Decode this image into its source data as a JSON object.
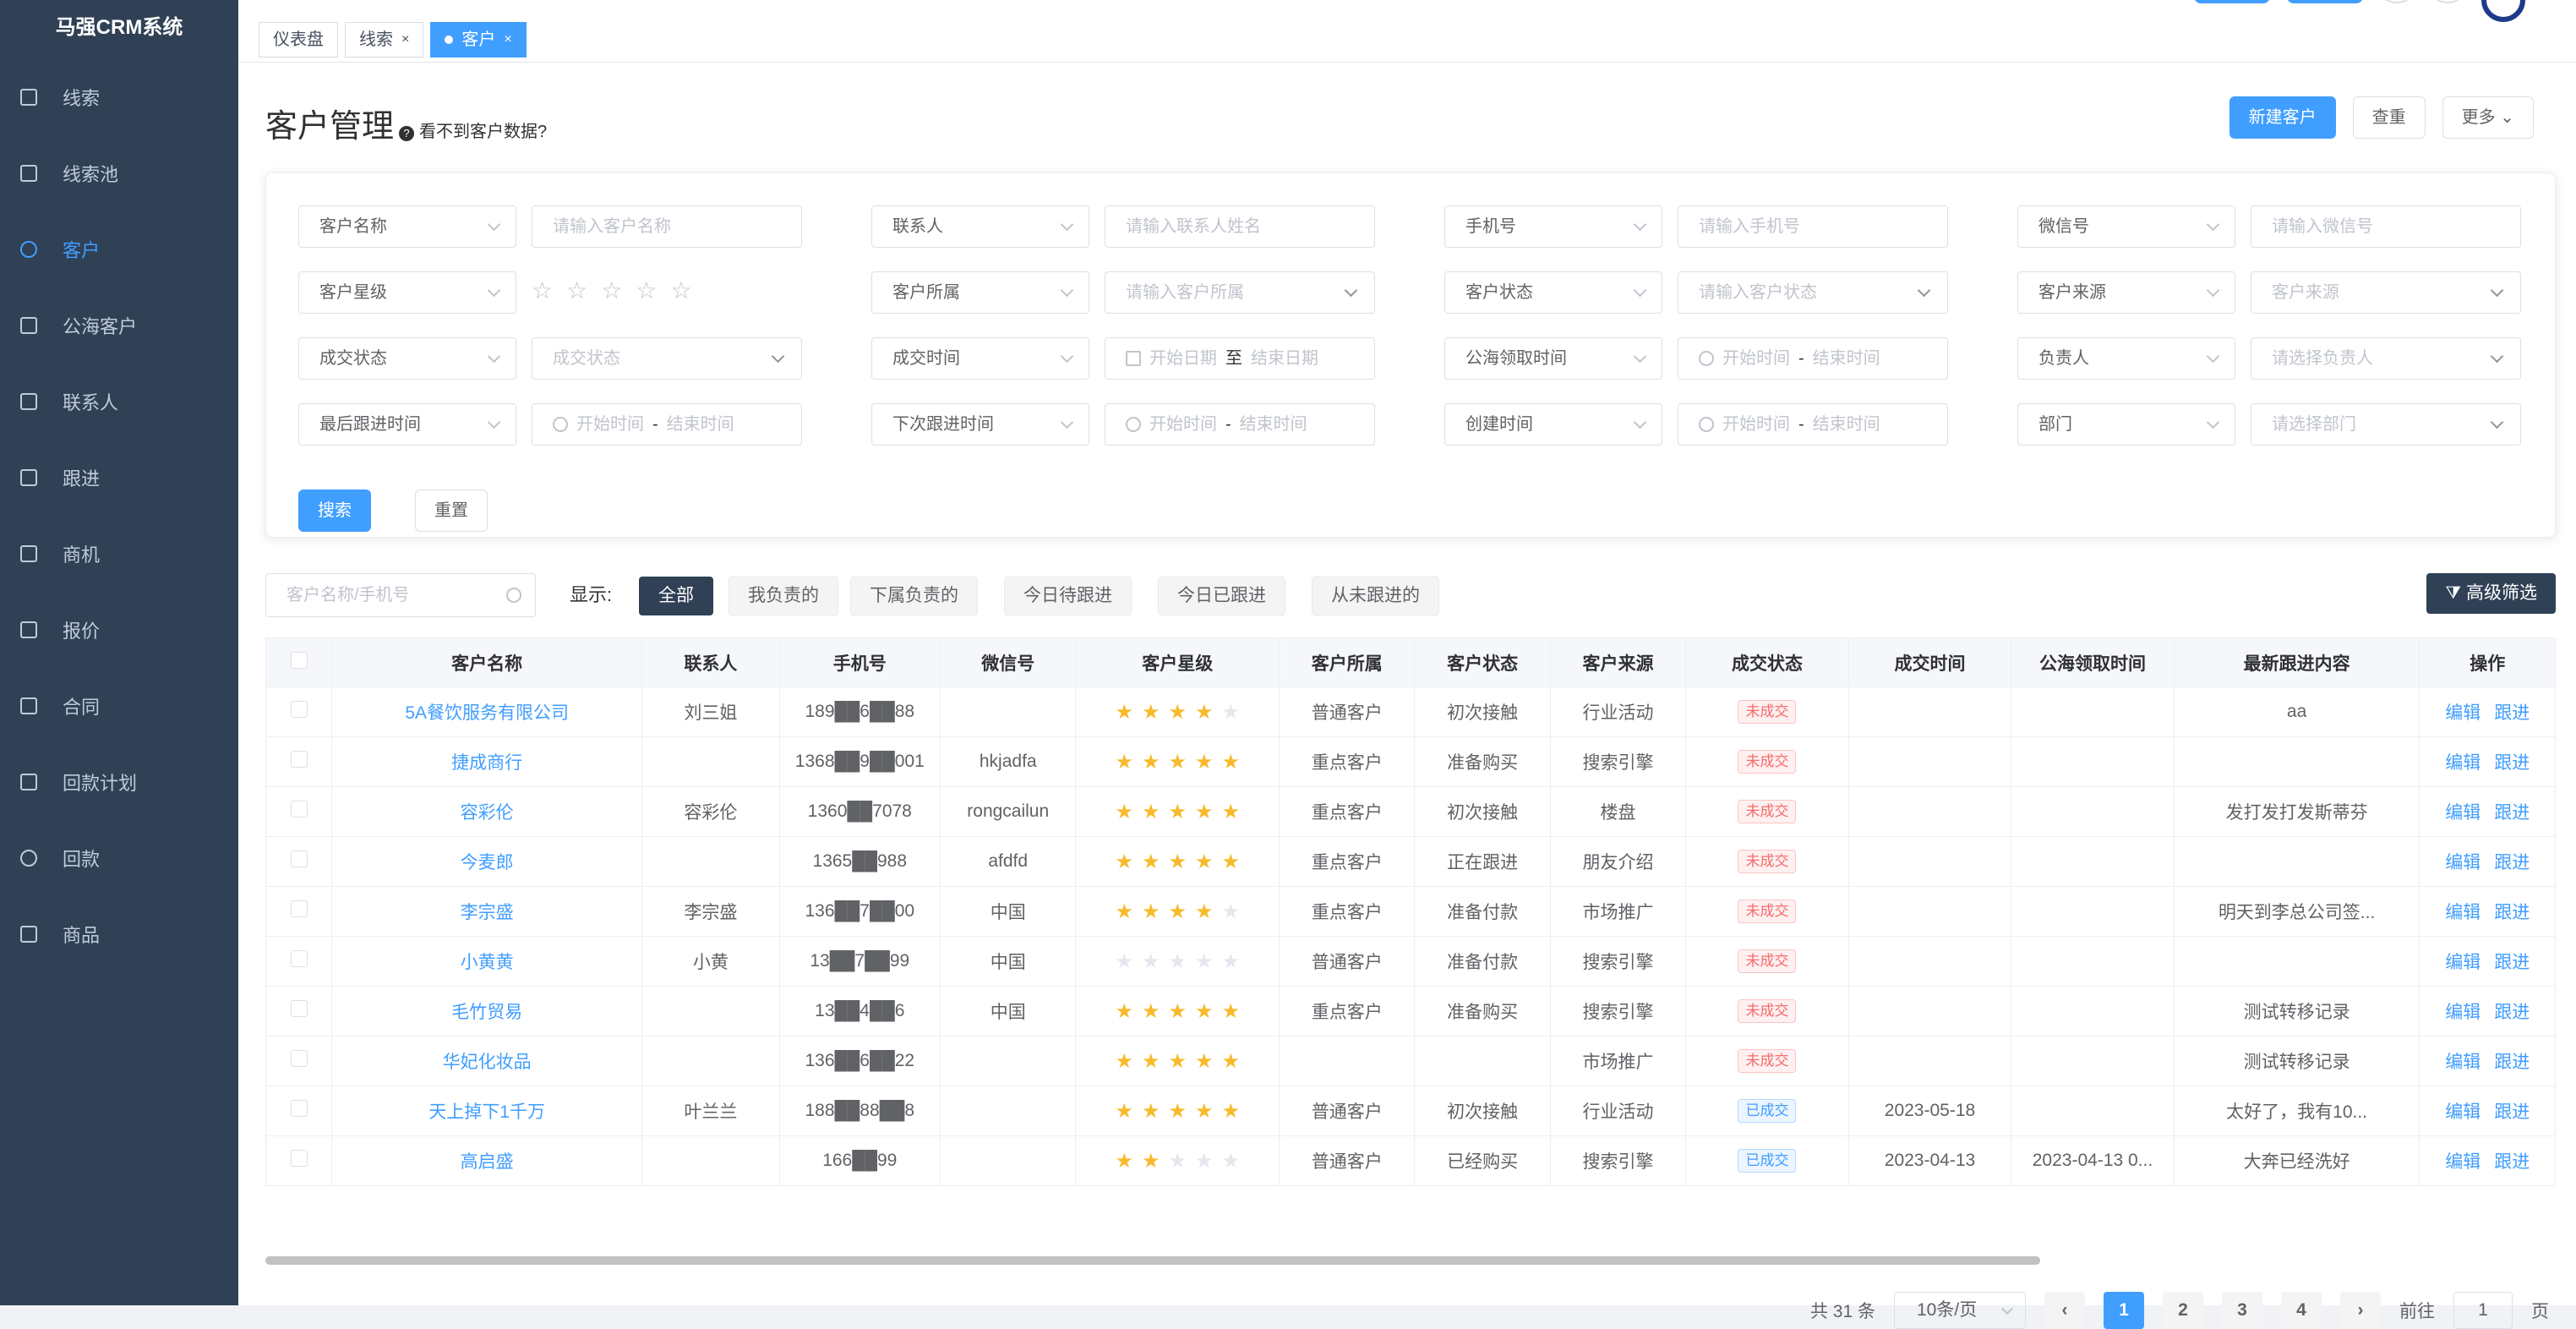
{
  "app": {
    "title": "马强CRM系统"
  },
  "sidebar": {
    "items": [
      {
        "label": "线索",
        "icon": "edit-icon"
      },
      {
        "label": "线索池",
        "icon": "calendar-icon"
      },
      {
        "label": "客户",
        "icon": "customer-icon",
        "active": true
      },
      {
        "label": "公海客户",
        "icon": "user-icon"
      },
      {
        "label": "联系人",
        "icon": "contact-icon"
      },
      {
        "label": "跟进",
        "icon": "document-icon"
      },
      {
        "label": "商机",
        "icon": "opportunity-icon"
      },
      {
        "label": "报价",
        "icon": "quote-icon"
      },
      {
        "label": "合同",
        "icon": "contract-icon"
      },
      {
        "label": "回款计划",
        "icon": "plan-icon"
      },
      {
        "label": "回款",
        "icon": "money-icon"
      },
      {
        "label": "商品",
        "icon": "bag-icon"
      }
    ]
  },
  "tabs": [
    {
      "label": "仪表盘"
    },
    {
      "label": "线索",
      "close": "×"
    },
    {
      "label": "客户",
      "close": "×",
      "active": true
    }
  ],
  "header": {
    "title": "客户管理",
    "help_icon": "?",
    "hint": "看不到客户数据?",
    "new_btn": "新建客户",
    "check_btn": "查重",
    "more_btn": "更多"
  },
  "filters": {
    "row1": [
      {
        "select": "客户名称",
        "placeholder": "请输入客户名称"
      },
      {
        "select": "联系人",
        "placeholder": "请输入联系人姓名"
      },
      {
        "select": "手机号",
        "placeholder": "请输入手机号"
      },
      {
        "select": "微信号",
        "placeholder": "请输入微信号"
      }
    ],
    "row2": [
      {
        "select": "客户星级"
      },
      {
        "select": "客户所属",
        "placeholder": "请输入客户所属"
      },
      {
        "select": "客户状态",
        "placeholder": "请输入客户状态"
      },
      {
        "select": "客户来源",
        "placeholder": "客户来源"
      }
    ],
    "row3": [
      {
        "select": "成交状态",
        "placeholder": "成交状态"
      },
      {
        "select": "成交时间",
        "start": "开始日期",
        "sep": "至",
        "end": "结束日期"
      },
      {
        "select": "公海领取时间",
        "start": "开始时间",
        "sep": "-",
        "end": "结束时间"
      },
      {
        "select": "负责人",
        "placeholder": "请选择负责人"
      }
    ],
    "row4": [
      {
        "select": "最后跟进时间",
        "start": "开始时间",
        "sep": "-",
        "end": "结束时间"
      },
      {
        "select": "下次跟进时间",
        "start": "开始时间",
        "sep": "-",
        "end": "结束时间"
      },
      {
        "select": "创建时间",
        "start": "开始时间",
        "sep": "-",
        "end": "结束时间"
      },
      {
        "select": "部门",
        "placeholder": "请选择部门"
      }
    ],
    "search_btn": "搜索",
    "reset_btn": "重置"
  },
  "toolbar": {
    "search_placeholder": "客户名称/手机号",
    "show_label": "显示:",
    "segments": [
      "全部",
      "我负责的",
      "下属负责的",
      "今日待跟进",
      "今日已跟进",
      "从未跟进的"
    ],
    "active_segment": "全部",
    "advanced_btn": "高级筛选"
  },
  "table": {
    "columns": [
      "客户名称",
      "联系人",
      "手机号",
      "微信号",
      "客户星级",
      "客户所属",
      "客户状态",
      "客户来源",
      "成交状态",
      "成交时间",
      "公海领取时间",
      "最新跟进内容",
      "操作"
    ],
    "edit_label": "编辑",
    "follow_label": "跟进",
    "rows": [
      {
        "name": "5A餐饮服务有限公司",
        "contact": "刘三姐",
        "phone": "189██6██88",
        "wechat": "",
        "stars": 4,
        "owner": "普通客户",
        "status": "初次接触",
        "source": "行业活动",
        "deal": "未成交",
        "deal_time": "",
        "pool_time": "",
        "latest": "aa"
      },
      {
        "name": "捷成商行",
        "contact": "",
        "phone": "1368██9██001",
        "wechat": "hkjadfa",
        "stars": 5,
        "owner": "重点客户",
        "status": "准备购买",
        "source": "搜索引擎",
        "deal": "未成交",
        "deal_time": "",
        "pool_time": "",
        "latest": ""
      },
      {
        "name": "容彩伦",
        "contact": "容彩伦",
        "phone": "1360██7078",
        "wechat": "rongcailun",
        "stars": 5,
        "owner": "重点客户",
        "status": "初次接触",
        "source": "楼盘",
        "deal": "未成交",
        "deal_time": "",
        "pool_time": "",
        "latest": "发打发打发斯蒂芬"
      },
      {
        "name": "今麦郎",
        "contact": "",
        "phone": "1365██988",
        "wechat": "afdfd",
        "stars": 5,
        "owner": "重点客户",
        "status": "正在跟进",
        "source": "朋友介绍",
        "deal": "未成交",
        "deal_time": "",
        "pool_time": "",
        "latest": ""
      },
      {
        "name": "李宗盛",
        "contact": "李宗盛",
        "phone": "136██7██00",
        "wechat": "中国",
        "stars": 4,
        "owner": "重点客户",
        "status": "准备付款",
        "source": "市场推广",
        "deal": "未成交",
        "deal_time": "",
        "pool_time": "",
        "latest": "明天到李总公司签..."
      },
      {
        "name": "小黄黄",
        "contact": "小黄",
        "phone": "13██7██99",
        "wechat": "中国",
        "stars": 0,
        "owner": "普通客户",
        "status": "准备付款",
        "source": "搜索引擎",
        "deal": "未成交",
        "deal_time": "",
        "pool_time": "",
        "latest": ""
      },
      {
        "name": "毛竹贸易",
        "contact": "",
        "phone": "13██4██6",
        "wechat": "中国",
        "stars": 5,
        "owner": "重点客户",
        "status": "准备购买",
        "source": "搜索引擎",
        "deal": "未成交",
        "deal_time": "",
        "pool_time": "",
        "latest": "测试转移记录"
      },
      {
        "name": "华妃化妆品",
        "contact": "",
        "phone": "136██6██22",
        "wechat": "",
        "stars": 5,
        "owner": "",
        "status": "",
        "source": "市场推广",
        "deal": "未成交",
        "deal_time": "",
        "pool_time": "",
        "latest": "测试转移记录"
      },
      {
        "name": "天上掉下1千万",
        "contact": "叶兰兰",
        "phone": "188██88██8",
        "wechat": "",
        "stars": 5,
        "owner": "普通客户",
        "status": "初次接触",
        "source": "行业活动",
        "deal": "已成交",
        "deal_time": "2023-05-18",
        "pool_time": "",
        "latest": "太好了，我有10..."
      },
      {
        "name": "高启盛",
        "contact": "",
        "phone": "166██99",
        "wechat": "",
        "stars": 2,
        "owner": "普通客户",
        "status": "已经购买",
        "source": "搜索引擎",
        "deal": "已成交",
        "deal_time": "2023-04-13",
        "pool_time": "2023-04-13 0...",
        "latest": "大奔已经洗好"
      }
    ]
  },
  "pagination": {
    "total": "共 31 条",
    "page_size": "10条/页",
    "pages": [
      "1",
      "2",
      "3",
      "4"
    ],
    "current": "1",
    "goto_label": "前往",
    "goto_value": "1",
    "page_suffix": "页"
  },
  "colors": {
    "sidebar": "#304156",
    "accent": "#409eff",
    "star": "#f7ba2a"
  }
}
